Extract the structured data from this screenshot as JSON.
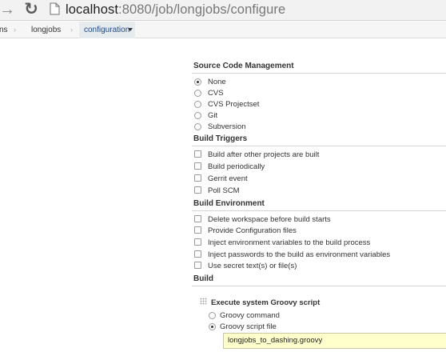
{
  "browser": {
    "url_host": "localhost",
    "url_path": ":8080/job/longjobs/configure"
  },
  "breadcrumb": {
    "items": [
      "ns",
      "longjobs",
      "configuration"
    ],
    "separator": "›"
  },
  "scm": {
    "header": "Source Code Management",
    "options": [
      {
        "label": "None",
        "selected": true
      },
      {
        "label": "CVS",
        "selected": false
      },
      {
        "label": "CVS Projectset",
        "selected": false
      },
      {
        "label": "Git",
        "selected": false
      },
      {
        "label": "Subversion",
        "selected": false
      }
    ]
  },
  "triggers": {
    "header": "Build Triggers",
    "options": [
      {
        "label": "Build after other projects are built",
        "checked": false
      },
      {
        "label": "Build periodically",
        "checked": false
      },
      {
        "label": "Gerrit event",
        "checked": false
      },
      {
        "label": "Poll SCM",
        "checked": false
      }
    ]
  },
  "environment": {
    "header": "Build Environment",
    "options": [
      {
        "label": "Delete workspace before build starts",
        "checked": false
      },
      {
        "label": "Provide Configuration files",
        "checked": false
      },
      {
        "label": "Inject environment variables to the build process",
        "checked": false
      },
      {
        "label": "Inject passwords to the build as environment variables",
        "checked": false
      },
      {
        "label": "Use secret text(s) or file(s)",
        "checked": false
      }
    ]
  },
  "build": {
    "header": "Build",
    "step_title": "Execute system Groovy script",
    "options": [
      {
        "label": "Groovy command",
        "selected": false
      },
      {
        "label": "Groovy script file",
        "selected": true
      }
    ],
    "script_file_value": "longjobs_to_dashing.groovy"
  },
  "colors": {
    "input_bg": "#ffffcc",
    "crumb_active_bg": "#e6ebee",
    "link": "#204a87"
  }
}
